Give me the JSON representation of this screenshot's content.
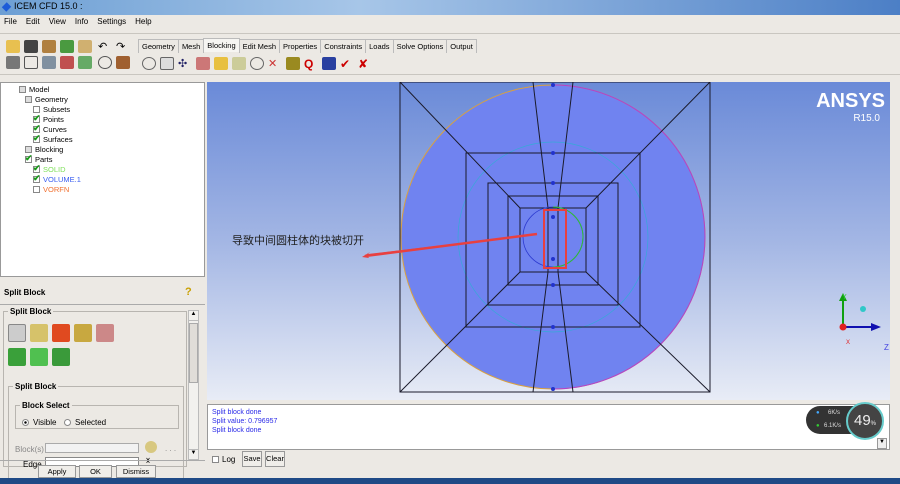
{
  "window": {
    "title": "ICEM CFD 15.0 :"
  },
  "menu": [
    "File",
    "Edit",
    "View",
    "Info",
    "Settings",
    "Help"
  ],
  "tabs": [
    "Geometry",
    "Mesh",
    "Blocking",
    "Edit Mesh",
    "Properties",
    "Constraints",
    "Loads",
    "Solve Options",
    "Output"
  ],
  "active_tab": "Blocking",
  "tree": [
    {
      "label": "Model",
      "checked": "partial",
      "color": "#000000"
    },
    {
      "label": "Geometry",
      "checked": "partial",
      "color": "#000000"
    },
    {
      "label": "Subsets",
      "checked": "off",
      "color": "#000000"
    },
    {
      "label": "Points",
      "checked": "on",
      "color": "#000000"
    },
    {
      "label": "Curves",
      "checked": "on",
      "color": "#000000"
    },
    {
      "label": "Surfaces",
      "checked": "on",
      "color": "#000000"
    },
    {
      "label": "Blocking",
      "checked": "partial",
      "color": "#000000"
    },
    {
      "label": "Parts",
      "checked": "on",
      "color": "#000000"
    },
    {
      "label": "SOLID",
      "checked": "on",
      "color": "#7fe05a"
    },
    {
      "label": "VOLUME.1",
      "checked": "on",
      "color": "#3a5ef0"
    },
    {
      "label": "VORFN",
      "checked": "off",
      "color": "#f07030"
    }
  ],
  "panel": {
    "title": "Split Block",
    "group": "Split Block",
    "sub_group": "Split Block",
    "block_select": "Block Select",
    "radio_visible": "Visible",
    "radio_selected": "Selected",
    "blocks_label": "Block(s)",
    "edge_label": "Edge",
    "dots": ". . .",
    "apply": "Apply",
    "ok": "OK",
    "dismiss": "Dismiss"
  },
  "viewport": {
    "annotation": "导致中间圆柱体的块被切开",
    "brand": "ANSYS",
    "version": "R15.0",
    "axis_y": "Y",
    "axis_z": "Z",
    "axis_x": "X"
  },
  "messages": [
    "Split block done",
    "Split value: 0.796957",
    "Split block done"
  ],
  "log": {
    "log_label": "Log",
    "save": "Save",
    "clear": "Clear"
  },
  "netmon": {
    "up": "6K/s",
    "down": "6.1K/s",
    "percent": "49",
    "unit": "%"
  },
  "colors": {
    "viewport_top": "#6a8ad8",
    "cylinder": "#7083f0",
    "highlight": "#e84040"
  }
}
